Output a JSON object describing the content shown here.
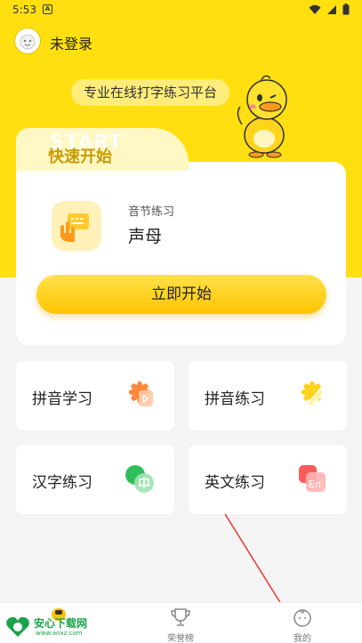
{
  "status_bar": {
    "time": "5:53",
    "app_indicator": "A",
    "icons": [
      "wifi-icon",
      "signal-icon",
      "battery-icon"
    ]
  },
  "header": {
    "login_text": "未登录",
    "avatar_icon": "avatar-icon"
  },
  "slogan": "专业在线打字练习平台",
  "quick_start": {
    "watermark": "START",
    "title": "快速开始",
    "practice_category": "音节练习",
    "practice_name": "声母",
    "start_button": "立即开始"
  },
  "grid": [
    {
      "label": "拼音学习",
      "icon": "pinyin-learn-icon",
      "color": "#ff8a3d"
    },
    {
      "label": "拼音练习",
      "icon": "pinyin-practice-icon",
      "color": "#ffd21c"
    },
    {
      "label": "汉字练习",
      "icon": "hanzi-practice-icon",
      "color": "#2fbf5a"
    },
    {
      "label": "英文练习",
      "icon": "english-practice-icon",
      "color": "#ff5a5a"
    }
  ],
  "bottom_nav": [
    {
      "label": "",
      "icon": "home-icon"
    },
    {
      "label": "荣誉榜",
      "icon": "trophy-icon"
    },
    {
      "label": "我的",
      "icon": "profile-icon"
    }
  ],
  "watermark": {
    "title": "安心下载网",
    "url": "www.anxz.com"
  },
  "colors": {
    "brand_yellow": "#ffdf10",
    "button_yellow": "#ffc400",
    "background": "#f4f4f4"
  }
}
